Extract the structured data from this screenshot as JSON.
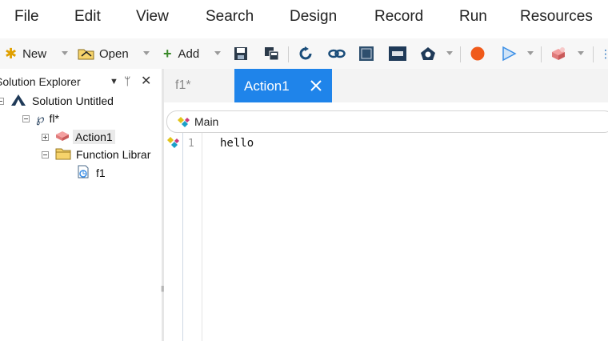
{
  "menu": {
    "items": [
      "File",
      "Edit",
      "View",
      "Search",
      "Design",
      "Record",
      "Run",
      "Resources"
    ]
  },
  "toolbar": {
    "new_label": "New",
    "open_label": "Open",
    "add_label": "Add"
  },
  "explorer": {
    "title": "Solution Explorer",
    "tree": {
      "solution": "Solution Untitled",
      "test": "fl*",
      "action": "Action1",
      "function_library": "Function Librar",
      "file": "f1"
    }
  },
  "editor": {
    "tabs": [
      {
        "label": "f1*",
        "active": false
      },
      {
        "label": "Action1",
        "active": true
      }
    ],
    "scope_combo": "Main",
    "lines": [
      {
        "number": "1",
        "text": "hello"
      }
    ]
  },
  "colors": {
    "accent": "#1f84ea",
    "record": "#f05a1a",
    "run": "#3a8ee6",
    "toolbar_bg": "#f7f7f7",
    "tabbar_bg": "#f3f3f3"
  }
}
